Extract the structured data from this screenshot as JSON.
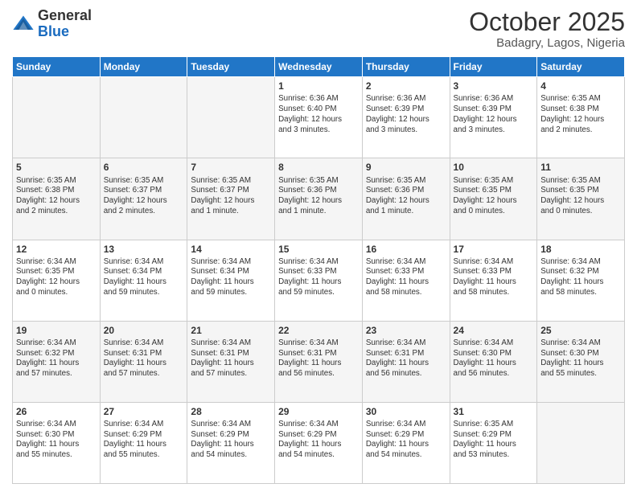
{
  "header": {
    "logo_general": "General",
    "logo_blue": "Blue",
    "month_title": "October 2025",
    "subtitle": "Badagry, Lagos, Nigeria"
  },
  "days_of_week": [
    "Sunday",
    "Monday",
    "Tuesday",
    "Wednesday",
    "Thursday",
    "Friday",
    "Saturday"
  ],
  "weeks": [
    {
      "row_class": "row-odd",
      "days": [
        {
          "num": "",
          "info": "",
          "empty": true
        },
        {
          "num": "",
          "info": "",
          "empty": true
        },
        {
          "num": "",
          "info": "",
          "empty": true
        },
        {
          "num": "1",
          "info": "Sunrise: 6:36 AM\nSunset: 6:40 PM\nDaylight: 12 hours\nand 3 minutes.",
          "empty": false
        },
        {
          "num": "2",
          "info": "Sunrise: 6:36 AM\nSunset: 6:39 PM\nDaylight: 12 hours\nand 3 minutes.",
          "empty": false
        },
        {
          "num": "3",
          "info": "Sunrise: 6:36 AM\nSunset: 6:39 PM\nDaylight: 12 hours\nand 3 minutes.",
          "empty": false
        },
        {
          "num": "4",
          "info": "Sunrise: 6:35 AM\nSunset: 6:38 PM\nDaylight: 12 hours\nand 2 minutes.",
          "empty": false
        }
      ]
    },
    {
      "row_class": "row-even",
      "days": [
        {
          "num": "5",
          "info": "Sunrise: 6:35 AM\nSunset: 6:38 PM\nDaylight: 12 hours\nand 2 minutes.",
          "empty": false
        },
        {
          "num": "6",
          "info": "Sunrise: 6:35 AM\nSunset: 6:37 PM\nDaylight: 12 hours\nand 2 minutes.",
          "empty": false
        },
        {
          "num": "7",
          "info": "Sunrise: 6:35 AM\nSunset: 6:37 PM\nDaylight: 12 hours\nand 1 minute.",
          "empty": false
        },
        {
          "num": "8",
          "info": "Sunrise: 6:35 AM\nSunset: 6:36 PM\nDaylight: 12 hours\nand 1 minute.",
          "empty": false
        },
        {
          "num": "9",
          "info": "Sunrise: 6:35 AM\nSunset: 6:36 PM\nDaylight: 12 hours\nand 1 minute.",
          "empty": false
        },
        {
          "num": "10",
          "info": "Sunrise: 6:35 AM\nSunset: 6:35 PM\nDaylight: 12 hours\nand 0 minutes.",
          "empty": false
        },
        {
          "num": "11",
          "info": "Sunrise: 6:35 AM\nSunset: 6:35 PM\nDaylight: 12 hours\nand 0 minutes.",
          "empty": false
        }
      ]
    },
    {
      "row_class": "row-odd",
      "days": [
        {
          "num": "12",
          "info": "Sunrise: 6:34 AM\nSunset: 6:35 PM\nDaylight: 12 hours\nand 0 minutes.",
          "empty": false
        },
        {
          "num": "13",
          "info": "Sunrise: 6:34 AM\nSunset: 6:34 PM\nDaylight: 11 hours\nand 59 minutes.",
          "empty": false
        },
        {
          "num": "14",
          "info": "Sunrise: 6:34 AM\nSunset: 6:34 PM\nDaylight: 11 hours\nand 59 minutes.",
          "empty": false
        },
        {
          "num": "15",
          "info": "Sunrise: 6:34 AM\nSunset: 6:33 PM\nDaylight: 11 hours\nand 59 minutes.",
          "empty": false
        },
        {
          "num": "16",
          "info": "Sunrise: 6:34 AM\nSunset: 6:33 PM\nDaylight: 11 hours\nand 58 minutes.",
          "empty": false
        },
        {
          "num": "17",
          "info": "Sunrise: 6:34 AM\nSunset: 6:33 PM\nDaylight: 11 hours\nand 58 minutes.",
          "empty": false
        },
        {
          "num": "18",
          "info": "Sunrise: 6:34 AM\nSunset: 6:32 PM\nDaylight: 11 hours\nand 58 minutes.",
          "empty": false
        }
      ]
    },
    {
      "row_class": "row-even",
      "days": [
        {
          "num": "19",
          "info": "Sunrise: 6:34 AM\nSunset: 6:32 PM\nDaylight: 11 hours\nand 57 minutes.",
          "empty": false
        },
        {
          "num": "20",
          "info": "Sunrise: 6:34 AM\nSunset: 6:31 PM\nDaylight: 11 hours\nand 57 minutes.",
          "empty": false
        },
        {
          "num": "21",
          "info": "Sunrise: 6:34 AM\nSunset: 6:31 PM\nDaylight: 11 hours\nand 57 minutes.",
          "empty": false
        },
        {
          "num": "22",
          "info": "Sunrise: 6:34 AM\nSunset: 6:31 PM\nDaylight: 11 hours\nand 56 minutes.",
          "empty": false
        },
        {
          "num": "23",
          "info": "Sunrise: 6:34 AM\nSunset: 6:31 PM\nDaylight: 11 hours\nand 56 minutes.",
          "empty": false
        },
        {
          "num": "24",
          "info": "Sunrise: 6:34 AM\nSunset: 6:30 PM\nDaylight: 11 hours\nand 56 minutes.",
          "empty": false
        },
        {
          "num": "25",
          "info": "Sunrise: 6:34 AM\nSunset: 6:30 PM\nDaylight: 11 hours\nand 55 minutes.",
          "empty": false
        }
      ]
    },
    {
      "row_class": "row-odd",
      "days": [
        {
          "num": "26",
          "info": "Sunrise: 6:34 AM\nSunset: 6:30 PM\nDaylight: 11 hours\nand 55 minutes.",
          "empty": false
        },
        {
          "num": "27",
          "info": "Sunrise: 6:34 AM\nSunset: 6:29 PM\nDaylight: 11 hours\nand 55 minutes.",
          "empty": false
        },
        {
          "num": "28",
          "info": "Sunrise: 6:34 AM\nSunset: 6:29 PM\nDaylight: 11 hours\nand 54 minutes.",
          "empty": false
        },
        {
          "num": "29",
          "info": "Sunrise: 6:34 AM\nSunset: 6:29 PM\nDaylight: 11 hours\nand 54 minutes.",
          "empty": false
        },
        {
          "num": "30",
          "info": "Sunrise: 6:34 AM\nSunset: 6:29 PM\nDaylight: 11 hours\nand 54 minutes.",
          "empty": false
        },
        {
          "num": "31",
          "info": "Sunrise: 6:35 AM\nSunset: 6:29 PM\nDaylight: 11 hours\nand 53 minutes.",
          "empty": false
        },
        {
          "num": "",
          "info": "",
          "empty": true
        }
      ]
    }
  ]
}
